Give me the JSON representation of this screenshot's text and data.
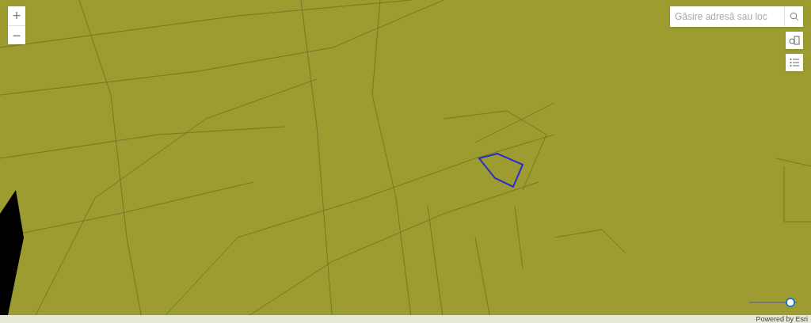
{
  "zoom_controls": [
    {
      "label": "+"
    },
    {
      "label": "−"
    }
  ],
  "search": {
    "placeholder": "Găsire adresă sau loc"
  },
  "time_slider": {
    "level": 0.87
  },
  "attribution": "Powered by Esri"
}
